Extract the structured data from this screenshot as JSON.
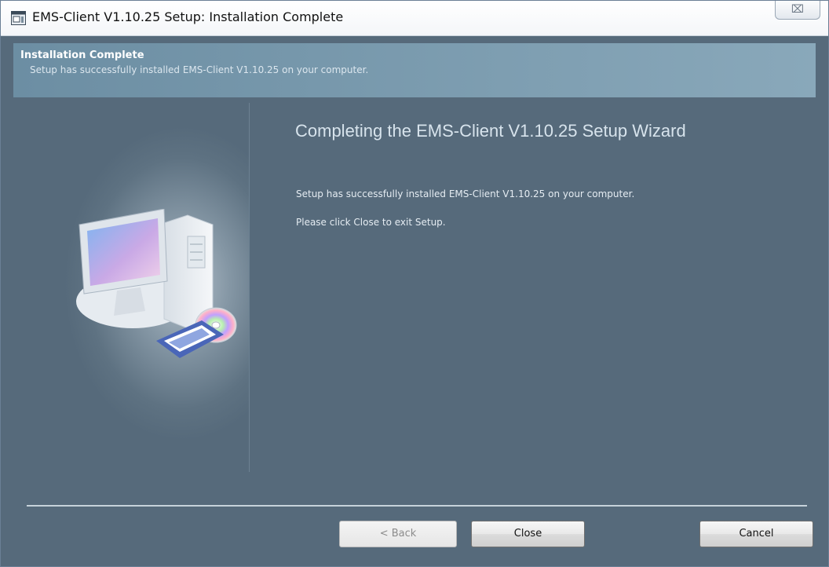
{
  "window": {
    "title": "EMS-Client V1.10.25 Setup: Installation Complete",
    "close_glyph": "⌧"
  },
  "header": {
    "title": "Installation Complete",
    "subtitle": "Setup has successfully installed EMS-Client V1.10.25 on your computer."
  },
  "main": {
    "heading": "Completing the EMS-Client V1.10.25 Setup Wizard",
    "message_installed": "Setup has successfully installed EMS-Client V1.10.25 on your computer.",
    "message_exit": "Please click Close to exit Setup."
  },
  "buttons": {
    "back_label": "< Back",
    "close_label": "Close",
    "cancel_label": "Cancel"
  },
  "icons": {
    "app": "installer-icon",
    "illustration": "computer-with-cd-illustration"
  },
  "colors": {
    "body_background": "#566a7b",
    "header_band": "#7b9cb0",
    "heading_text": "#d7e3ec"
  }
}
